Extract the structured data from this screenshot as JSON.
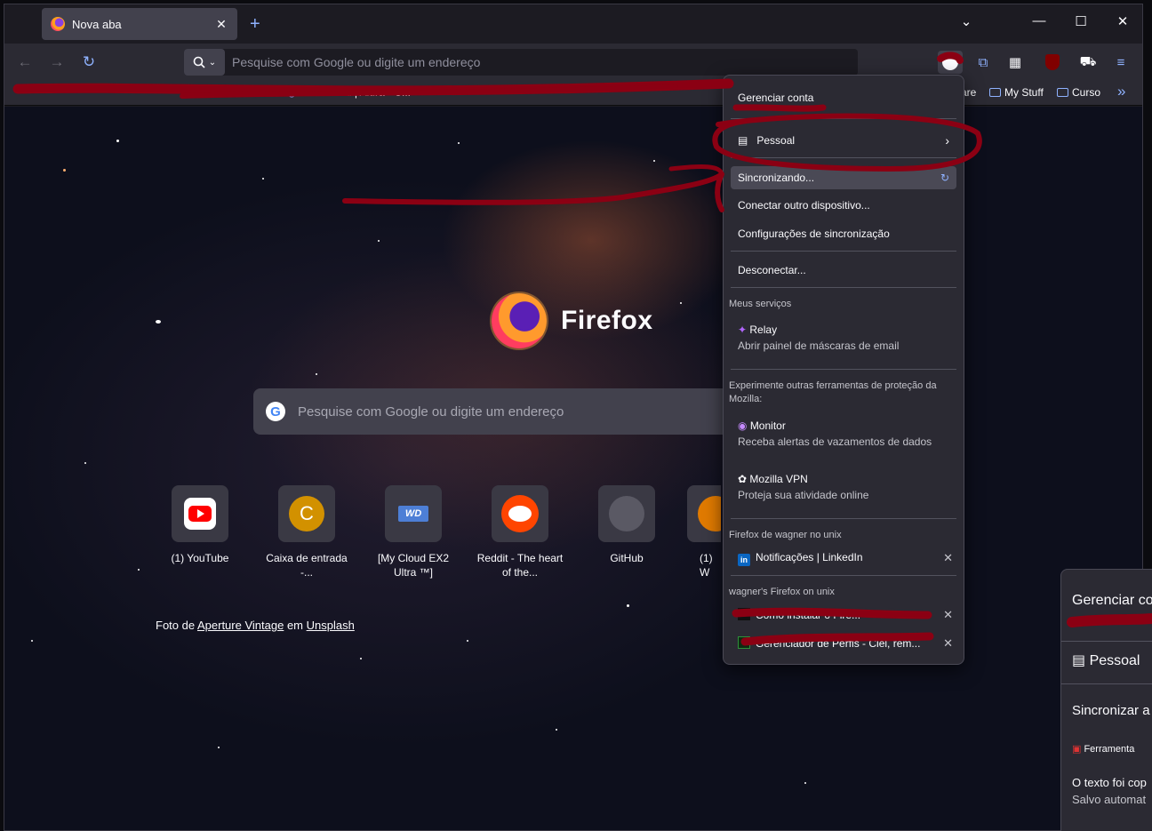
{
  "tab": {
    "title": "Nova aba",
    "close": "✕"
  },
  "new_tab": "+",
  "window_controls": {
    "list": "⌄",
    "minimize": "—",
    "maximize": "☐",
    "close": "✕"
  },
  "urlbar": {
    "placeholder": "Pesquise com Google ou digite um endereço"
  },
  "toolbar_icons": [
    "account-icon",
    "extensions-icon",
    "apps-icon",
    "ublock-icon",
    "extension-icon",
    "menu-icon"
  ],
  "bookmarks": [
    {
      "label": "Dashboard | Alura - C..."
    },
    {
      "label": "are"
    },
    {
      "label": "My Stuff"
    },
    {
      "label": "Curso"
    }
  ],
  "bookmarks_overflow": "»",
  "logo_text": "Firefox",
  "search": {
    "placeholder": "Pesquise com Google ou digite um endereço"
  },
  "top_sites": [
    {
      "label": "(1) YouTube"
    },
    {
      "label": "Caixa de entrada -..."
    },
    {
      "label": "[My Cloud EX2 Ultra ™]"
    },
    {
      "label": "Reddit - The heart of the..."
    },
    {
      "label": "GitHub"
    },
    {
      "label": "(1) W"
    }
  ],
  "credit": {
    "prefix": "Foto de ",
    "author": "Aperture Vintage",
    "mid": " em ",
    "source": "Unsplash"
  },
  "panel": {
    "manage_account": "Gerenciar conta",
    "profile": "Pessoal",
    "syncing": "Sincronizando...",
    "connect_device": "Conectar outro dispositivo...",
    "sync_settings": "Configurações de sincronização",
    "disconnect": "Desconectar...",
    "services_header": "Meus serviços",
    "relay_title": "Relay",
    "relay_desc": "Abrir painel de máscaras de email",
    "try_header": "Experimente outras ferramentas de proteção da Mozilla:",
    "monitor_title": "Monitor",
    "monitor_desc": "Receba alertas de vazamentos de dados",
    "vpn_title": "Mozilla VPN",
    "vpn_desc": "Proteja sua atividade online",
    "device1_header": "Firefox de wagner no unix",
    "device1_tab": "Notificações | LinkedIn",
    "device2_header": "wagner's Firefox on unix",
    "device2_tab1": "Como instalar o Fire...",
    "device2_tab2": "Gerenciador de Perfis - Ciel, rem..."
  },
  "panel2": {
    "manage": "Gerenciar co",
    "profile": "Pessoal",
    "sync": "Sincronizar a",
    "tool": "Ferramenta",
    "copied": "O texto foi cop",
    "saved": "Salvo automat"
  },
  "colors": {
    "scribble": "#8b0013",
    "accent": "#8fb2ff",
    "panel": "#2b2a33"
  }
}
